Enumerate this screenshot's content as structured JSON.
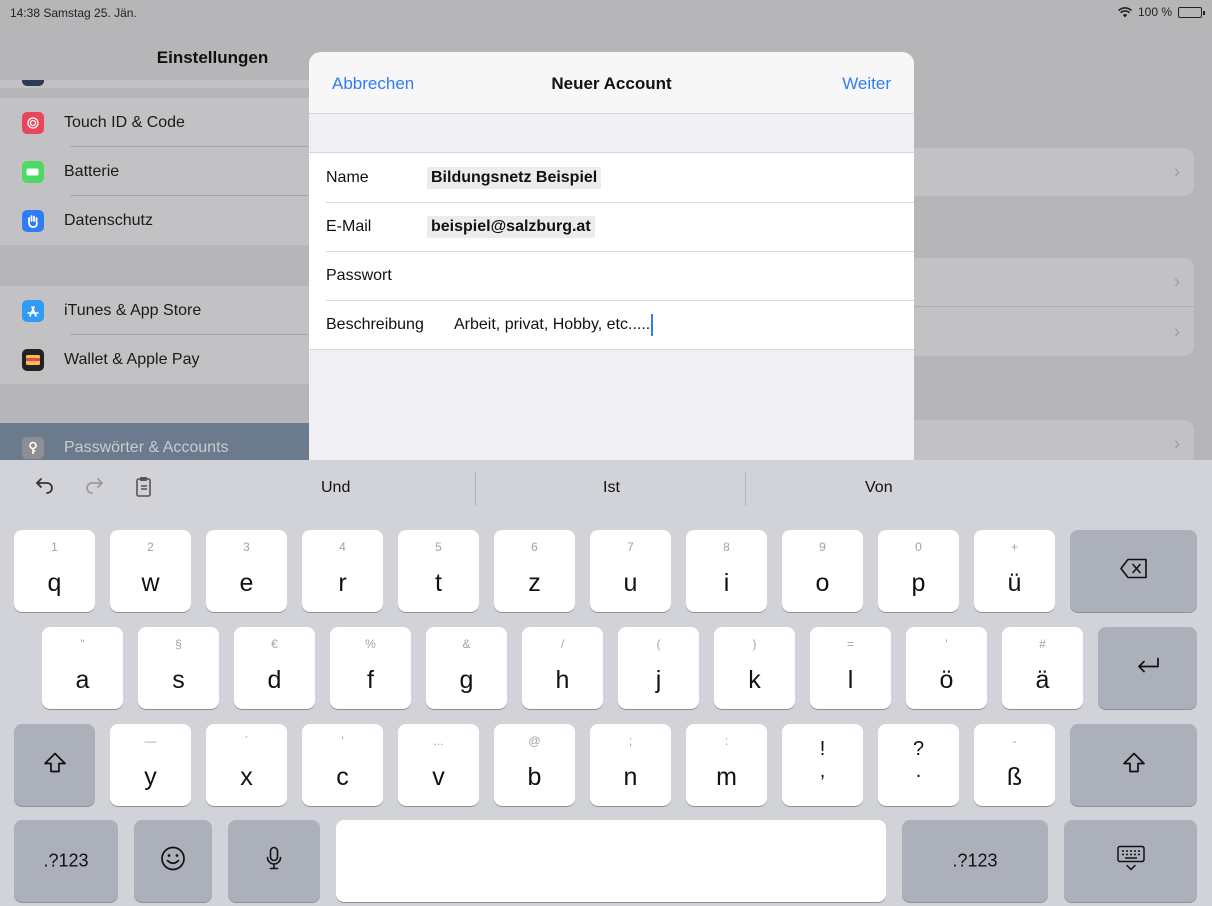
{
  "status": {
    "time_date": "14:38  Samstag 25. Jän.",
    "wifi_icon": "wifi-icon",
    "battery": "100 %"
  },
  "sidebar": {
    "title": "Einstellungen",
    "items": [
      {
        "label": "Touch ID & Code",
        "icon": "fingerprint-icon",
        "color": "#e8465a"
      },
      {
        "label": "Batterie",
        "icon": "battery-icon",
        "color": "#4cd964"
      },
      {
        "label": "Datenschutz",
        "icon": "hand-icon",
        "color": "#2f7cf6"
      },
      {
        "label": "iTunes & App Store",
        "icon": "appstore-icon",
        "color": "#2f9bf6"
      },
      {
        "label": "Wallet & Apple Pay",
        "icon": "wallet-icon",
        "color": "#222222"
      },
      {
        "label": "Passwörter & Accounts",
        "icon": "key-icon",
        "color": "#8e8e93"
      }
    ]
  },
  "modal": {
    "cancel": "Abbrechen",
    "title": "Neuer Account",
    "next": "Weiter",
    "fields": [
      {
        "label": "Name",
        "value": "Bildungsnetz Beispiel"
      },
      {
        "label": "E-Mail",
        "value": "beispiel@salzburg.at"
      },
      {
        "label": "Passwort",
        "value": ""
      },
      {
        "label": "Beschreibung",
        "value": "Arbeit, privat, Hobby, etc....."
      }
    ]
  },
  "keyboard": {
    "suggestions": [
      "Und",
      "Ist",
      "Von"
    ],
    "row1": [
      {
        "main": "q",
        "alt": "1"
      },
      {
        "main": "w",
        "alt": "2"
      },
      {
        "main": "e",
        "alt": "3"
      },
      {
        "main": "r",
        "alt": "4"
      },
      {
        "main": "t",
        "alt": "5"
      },
      {
        "main": "z",
        "alt": "6"
      },
      {
        "main": "u",
        "alt": "7"
      },
      {
        "main": "i",
        "alt": "8"
      },
      {
        "main": "o",
        "alt": "9"
      },
      {
        "main": "p",
        "alt": "0"
      },
      {
        "main": "ü",
        "alt": "+"
      }
    ],
    "row2": [
      {
        "main": "a",
        "alt": "\""
      },
      {
        "main": "s",
        "alt": "§"
      },
      {
        "main": "d",
        "alt": "€"
      },
      {
        "main": "f",
        "alt": "%"
      },
      {
        "main": "g",
        "alt": "&"
      },
      {
        "main": "h",
        "alt": "/"
      },
      {
        "main": "j",
        "alt": "("
      },
      {
        "main": "k",
        "alt": ")"
      },
      {
        "main": "l",
        "alt": "="
      },
      {
        "main": "ö",
        "alt": "'"
      },
      {
        "main": "ä",
        "alt": "#"
      }
    ],
    "row3": [
      {
        "main": "y",
        "alt": "—"
      },
      {
        "main": "x",
        "alt": "`"
      },
      {
        "main": "c",
        "alt": "'"
      },
      {
        "main": "v",
        "alt": "..."
      },
      {
        "main": "b",
        "alt": "@"
      },
      {
        "main": "n",
        "alt": ";"
      },
      {
        "main": "m",
        "alt": ":"
      }
    ],
    "punct": [
      {
        "top": "!",
        "bottom": ","
      },
      {
        "top": "?",
        "bottom": "."
      }
    ],
    "eszett": {
      "main": "ß",
      "alt": "-"
    },
    "numbers_label": ".?123"
  }
}
